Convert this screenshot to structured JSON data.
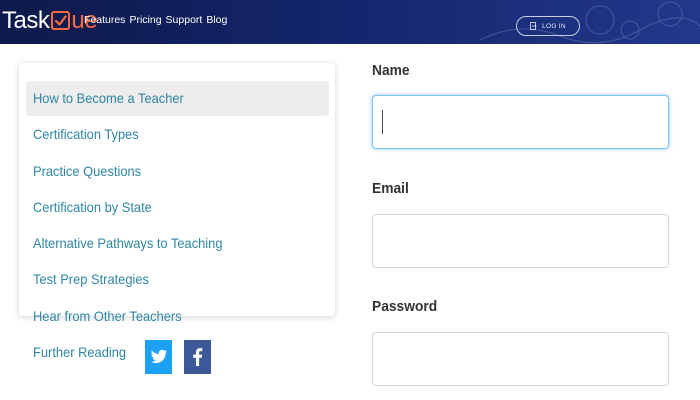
{
  "header": {
    "logo": {
      "prefix": "Task",
      "suffix": "ue"
    },
    "nav": [
      "Features",
      "Pricing",
      "Support",
      "Blog"
    ],
    "login_label": "LOG IN"
  },
  "sidebar": {
    "items": [
      {
        "label": "How to Become a Teacher",
        "active": true
      },
      {
        "label": "Certification Types",
        "active": false
      },
      {
        "label": "Practice Questions",
        "active": false
      },
      {
        "label": "Certification by State",
        "active": false
      },
      {
        "label": "Alternative Pathways to Teaching",
        "active": false
      },
      {
        "label": "Test Prep Strategies",
        "active": false
      },
      {
        "label": "Hear from Other Teachers",
        "active": false
      }
    ],
    "further_reading": "Further Reading",
    "social": [
      "twitter-icon",
      "facebook-icon"
    ]
  },
  "form": {
    "name": {
      "label": "Name",
      "value": "",
      "placeholder": ""
    },
    "email": {
      "label": "Email",
      "value": "",
      "placeholder": ""
    },
    "password": {
      "label": "Password",
      "value": "",
      "placeholder": ""
    }
  },
  "colors": {
    "header_bg": "#13246a",
    "logo_accent": "#ff6a3d",
    "link": "#2e86a3",
    "twitter": "#1da1f2",
    "facebook": "#3b5998",
    "focus_border": "#7fc3e8"
  }
}
